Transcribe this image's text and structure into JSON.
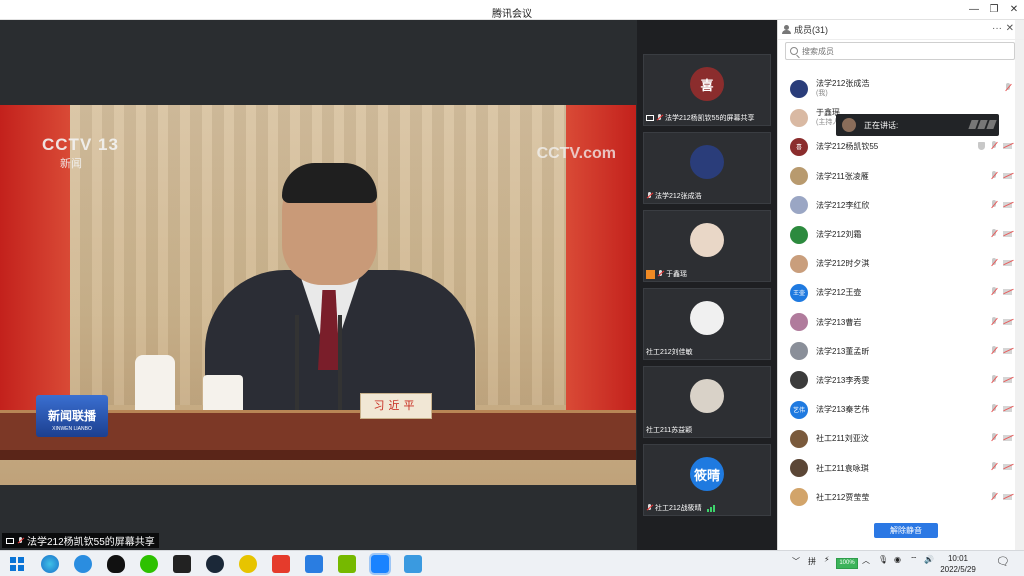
{
  "window": {
    "title": "腾讯会议",
    "buttons": [
      "—",
      "❐",
      "✕"
    ]
  },
  "share": {
    "caption": "法学212杨凯钦55的屏幕共享",
    "overlay": {
      "channel": "CCTV 13",
      "channel_sub": "新闻",
      "watermark": "CCTV.com",
      "nameplate": "习近平",
      "news_badge": "新闻联播",
      "news_badge_en": "XINWEN LIANBO"
    }
  },
  "tiles": [
    {
      "avatar_text": "喜",
      "avatar_color": "#8b2d2d",
      "label": "法学212杨凯钦55的屏幕共享",
      "icon": "screen-share-icon"
    },
    {
      "avatar_text": "",
      "avatar_color": "#2a3d7a",
      "label": "法学212张成浩",
      "icon": "mic-muted-icon"
    },
    {
      "avatar_text": "",
      "avatar_color": "#e9d7c7",
      "label": "于鑫瑶",
      "icon": "host-icon"
    },
    {
      "avatar_text": "",
      "avatar_color": "#f0f0f0",
      "label": "社工212刘佳敏",
      "icon": "mic-muted-icon"
    },
    {
      "avatar_text": "",
      "avatar_color": "#d9d2c8",
      "label": "社工211苏益颖",
      "icon": "mic-muted-icon"
    },
    {
      "avatar_text": "筱晴",
      "avatar_color": "#1f7ae0",
      "label": "社工212战筱晴",
      "icon": "mic-muted-icon",
      "signal": true
    }
  ],
  "members_panel": {
    "title": "成员(31)",
    "more": "···",
    "close": "✕",
    "search_placeholder": "搜索成员",
    "speaking_label": "正在讲话:",
    "unmute_all": "解除静音",
    "members": [
      {
        "name": "法学212张成浩",
        "sub": "(我)",
        "color": "#2a3d7a",
        "avatar_text": ""
      },
      {
        "name": "于鑫瑶",
        "sub": "(主持人)",
        "color": "#d9b9a3",
        "avatar_text": ""
      },
      {
        "name": "法学212杨凯钦55",
        "sub": "",
        "color": "#8b2d2d",
        "avatar_text": "喜",
        "shield": true
      },
      {
        "name": "法学211张凌雁",
        "sub": "",
        "color": "#b89a6e",
        "avatar_text": ""
      },
      {
        "name": "法学212李红欣",
        "sub": "",
        "color": "#9aa6c4",
        "avatar_text": ""
      },
      {
        "name": "法学212刘霜",
        "sub": "",
        "color": "#2c8a3e",
        "avatar_text": ""
      },
      {
        "name": "法学212时夕淇",
        "sub": "",
        "color": "#c99e7c",
        "avatar_text": ""
      },
      {
        "name": "法学212王壶",
        "sub": "",
        "color": "#1f7ae0",
        "avatar_text": "王壶"
      },
      {
        "name": "法学213曹岩",
        "sub": "",
        "color": "#b07b9c",
        "avatar_text": ""
      },
      {
        "name": "法学213董孟昕",
        "sub": "",
        "color": "#8a8f99",
        "avatar_text": ""
      },
      {
        "name": "法学213李秀雯",
        "sub": "",
        "color": "#3b3b3b",
        "avatar_text": ""
      },
      {
        "name": "法学213秦艺伟",
        "sub": "",
        "color": "#1f7ae0",
        "avatar_text": "艺伟"
      },
      {
        "name": "社工211刘亚汶",
        "sub": "",
        "color": "#7a5a3c",
        "avatar_text": ""
      },
      {
        "name": "社工211袁咏琪",
        "sub": "",
        "color": "#5b4636",
        "avatar_text": ""
      },
      {
        "name": "社工212贾莹莹",
        "sub": "",
        "color": "#d2a46a",
        "avatar_text": ""
      }
    ]
  },
  "taskbar": {
    "battery": "100%",
    "time": "10:01",
    "date": "2022/5/29",
    "ime": "拼"
  }
}
